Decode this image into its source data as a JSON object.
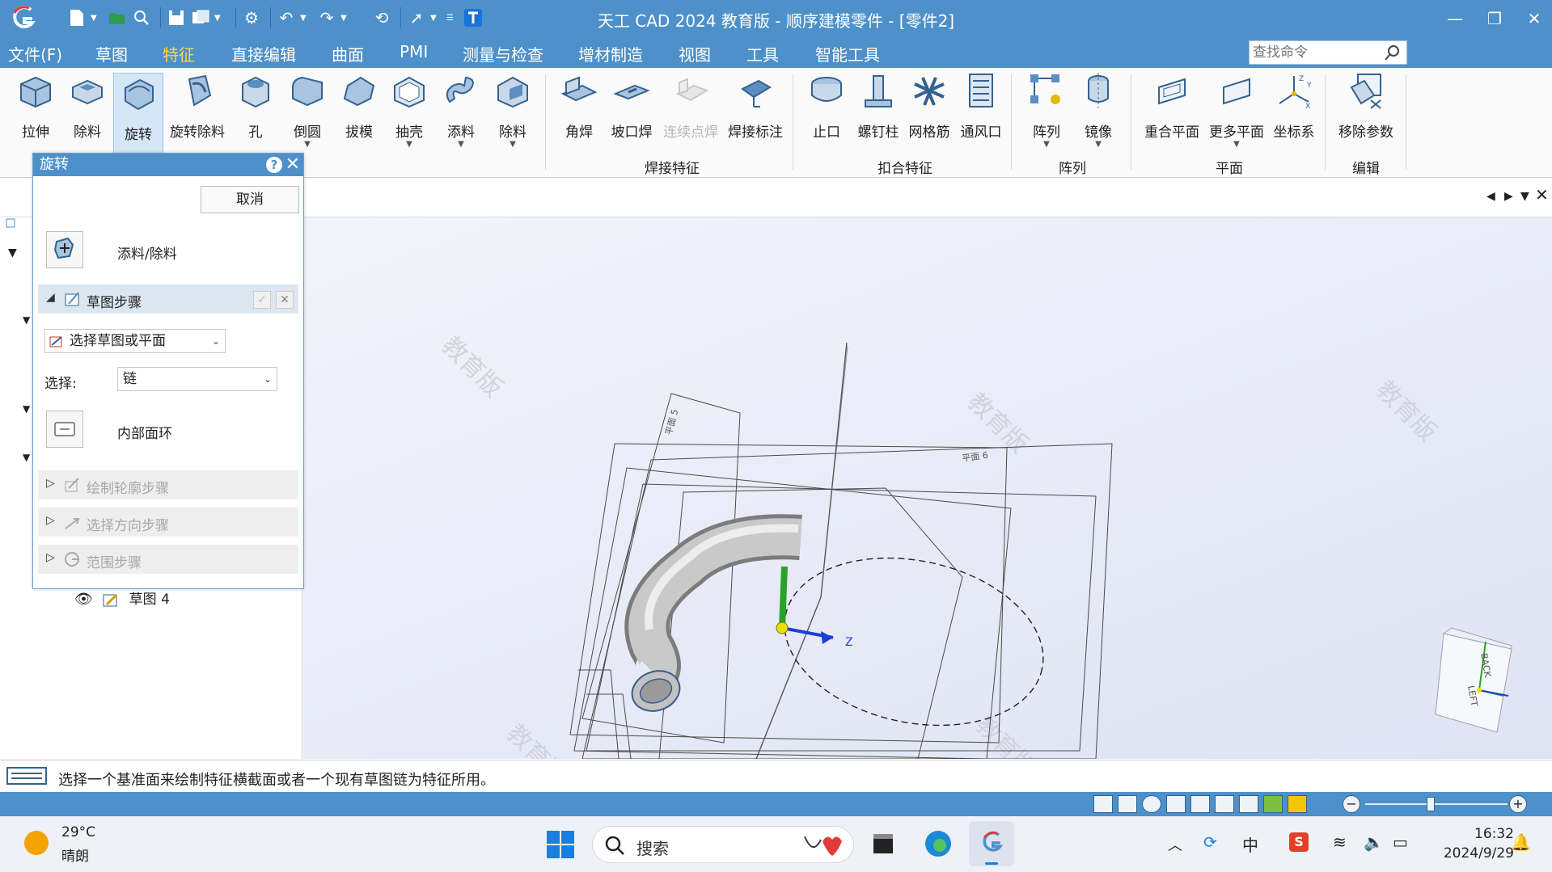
{
  "app": {
    "title": "天工 CAD 2024 教育版 - 顺序建模零件 - [零件2]"
  },
  "menu": {
    "items": [
      "文件(F)",
      "草图",
      "特征",
      "直接编辑",
      "曲面",
      "PMI",
      "测量与检查",
      "增材制造",
      "视图",
      "工具",
      "智能工具"
    ],
    "active": "特征",
    "search_placeholder": "查找命令",
    "help": "?"
  },
  "ribbon": {
    "buttons": [
      {
        "label": "拉伸"
      },
      {
        "label": "除料"
      },
      {
        "label": "旋转"
      },
      {
        "label": "旋转除料"
      },
      {
        "label": "孔"
      },
      {
        "label": "倒圆"
      },
      {
        "label": "拔模"
      },
      {
        "label": "抽壳"
      },
      {
        "label": "添料"
      },
      {
        "label": "除料"
      },
      {
        "label": "角焊"
      },
      {
        "label": "坡口焊"
      },
      {
        "label": "连续点焊"
      },
      {
        "label": "焊接标注"
      },
      {
        "label": "止口"
      },
      {
        "label": "螺钉柱"
      },
      {
        "label": "网格筋"
      },
      {
        "label": "通风口"
      },
      {
        "label": "阵列"
      },
      {
        "label": "镜像"
      },
      {
        "label": "重合平面"
      },
      {
        "label": "更多平面"
      },
      {
        "label": "坐标系"
      },
      {
        "label": "移除参数"
      }
    ],
    "groups": [
      "焊接特征",
      "扣合特征",
      "阵列",
      "平面",
      "编辑"
    ]
  },
  "dialog": {
    "title": "旋转",
    "cancel": "取消",
    "mode": "添料/除料",
    "sketch_step": "草图步骤",
    "sketch_select": "选择草图或平面",
    "select_label": "选择:",
    "select_value": "链",
    "inner_loop": "内部面环",
    "step_profile": "绘制轮廓步骤",
    "step_direction": "选择方向步骤",
    "step_extent": "范围步骤"
  },
  "tree": {
    "sketch4": "草图 4"
  },
  "viewport": {
    "plane5": "平面 5",
    "plane6": "平面 6",
    "axis_z": "Z",
    "watermark": "教育版",
    "cube_back": "BACK",
    "cube_left": "LEFT"
  },
  "prompt": "选择一个基准面来绘制特征横截面或者一个现有草图链为特征所用。",
  "taskbar": {
    "weather_temp": "29°C",
    "weather_desc": "晴朗",
    "search": "搜索",
    "ime": "中",
    "time": "16:32",
    "date": "2024/9/29"
  },
  "colors": {
    "accent": "#4e90c9",
    "active_tab": "#ffd44a"
  }
}
